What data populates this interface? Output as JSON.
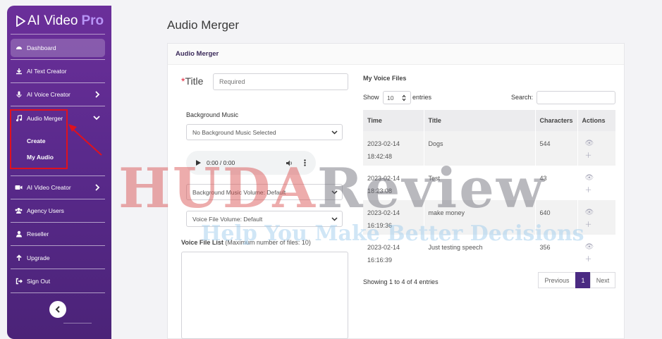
{
  "app": {
    "brand_main": "AI Video",
    "brand_pro": "Pro"
  },
  "sidebar": {
    "items": [
      {
        "label": "Dashboard",
        "icon": "dashboard-icon"
      },
      {
        "label": "AI Text Creator",
        "icon": "download-icon"
      },
      {
        "label": "AI Voice Creator",
        "icon": "microphone-icon"
      },
      {
        "label": "Audio Merger",
        "icon": "music-note-icon"
      },
      {
        "label": "AI Video Creator",
        "icon": "video-camera-icon"
      },
      {
        "label": "Agency Users",
        "icon": "users-icon"
      },
      {
        "label": "Reseller",
        "icon": "user-icon"
      },
      {
        "label": "Upgrade",
        "icon": "arrow-up-icon"
      },
      {
        "label": "Sign Out",
        "icon": "sign-out-icon"
      }
    ],
    "submenu": [
      "Create",
      "My Audio"
    ]
  },
  "page": {
    "title": "Audio Merger"
  },
  "card": {
    "header": "Audio Merger"
  },
  "form": {
    "title_star": "*",
    "title_label": "Title",
    "title_placeholder": "Required",
    "bg_music_label": "Background Music",
    "bg_music_value": "No Background Music Selected",
    "audio_time": "0:00 / 0:00",
    "bg_volume_value": "Background Music Volume: Default",
    "voice_volume_value": "Voice File Volume: Default",
    "voice_list_label": "Voice File List",
    "voice_list_hint": "(Maximum number of files: 10)"
  },
  "voice_files": {
    "heading": "My Voice Files",
    "show_label": "Show",
    "entries_value": "10",
    "entries_label": "entries",
    "search_label": "Search:",
    "columns": [
      "Time",
      "Title",
      "Characters",
      "Actions"
    ],
    "rows": [
      {
        "date": "2023-02-14",
        "time": "18:42:48",
        "title": "Dogs",
        "characters": "544"
      },
      {
        "date": "2023-02-14",
        "time": "18:23:08",
        "title": "Test",
        "characters": "43"
      },
      {
        "date": "2023-02-14",
        "time": "16:19:36",
        "title": "make money",
        "characters": "640"
      },
      {
        "date": "2023-02-14",
        "time": "16:16:39",
        "title": "Just testing speech",
        "characters": "356"
      }
    ],
    "info": "Showing 1 to 4 of 4 entries",
    "pagination": {
      "previous": "Previous",
      "current": "1",
      "next": "Next"
    }
  },
  "watermark": {
    "part1": "HUDA",
    "part2": "Review",
    "tagline": "Help You Make Better Decisions"
  },
  "colors": {
    "sidebar": "#5a2a8c",
    "accent": "#4a2a82",
    "highlight": "#e0111e"
  }
}
